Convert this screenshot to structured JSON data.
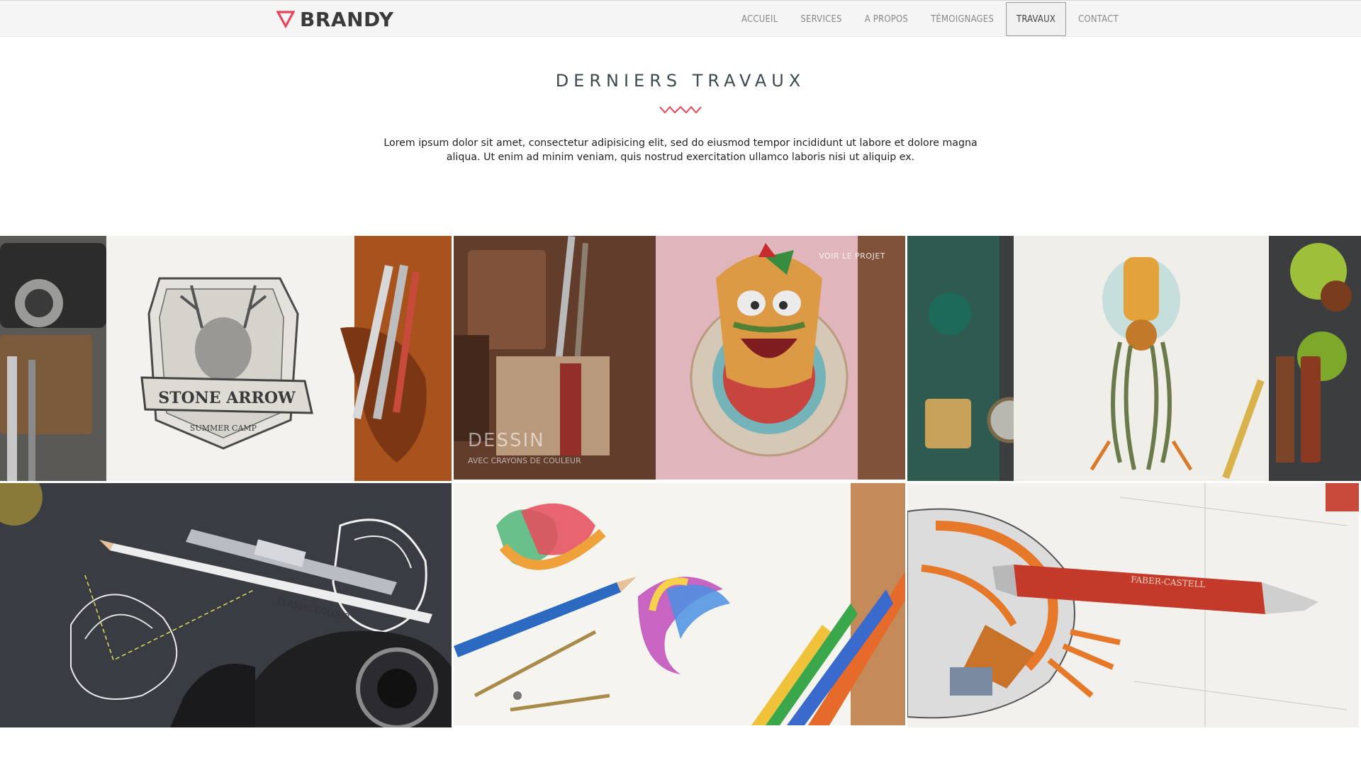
{
  "brand": {
    "name": "BRANDY",
    "logo_icon": "triangle-down-icon",
    "accent": "#e8455c"
  },
  "nav": {
    "items": [
      {
        "label": "ACCUEIL",
        "active": false
      },
      {
        "label": "SERVICES",
        "active": false
      },
      {
        "label": "A PROPOS",
        "active": false
      },
      {
        "label": "TÉMOIGNAGES",
        "active": false
      },
      {
        "label": "TRAVAUX",
        "active": true
      },
      {
        "label": "CONTACT",
        "active": false
      }
    ]
  },
  "section": {
    "title": "DERNIERS TRAVAUX",
    "divider_icon": "zigzag-divider-icon",
    "lead": "Lorem ipsum dolor sit amet, consectetur adipisicing elit, sed do eiusmod tempor incididunt ut labore et dolore magna aliqua. Ut enim ad minim veniam, quis nostrud exercitation ullamco laboris nisi ut aliquip ex."
  },
  "portfolio": {
    "hovered_tile": {
      "link": "VOIR LE PROJET",
      "title": "DESSIN",
      "subtitle": "AVEC CRAYONS DE COULEUR"
    },
    "tiles": [
      {
        "subject": "deer badge sketch with leather case and pens",
        "badge_text": "STONE ARROW",
        "badge_sub": "SUMMER CAMP"
      },
      {
        "subject": "cartoon taco character on pink paper"
      },
      {
        "subject": "mechanical jellyfish robot drawing"
      },
      {
        "subject": "pencils and camera on dark paper",
        "pencil_text": "CLASSIC COLOUR"
      },
      {
        "subject": "colorful ribbon logos with compass and pencils"
      },
      {
        "subject": "spaceship sketch with red pen",
        "pen_text": "FABER-CASTELL"
      }
    ]
  }
}
